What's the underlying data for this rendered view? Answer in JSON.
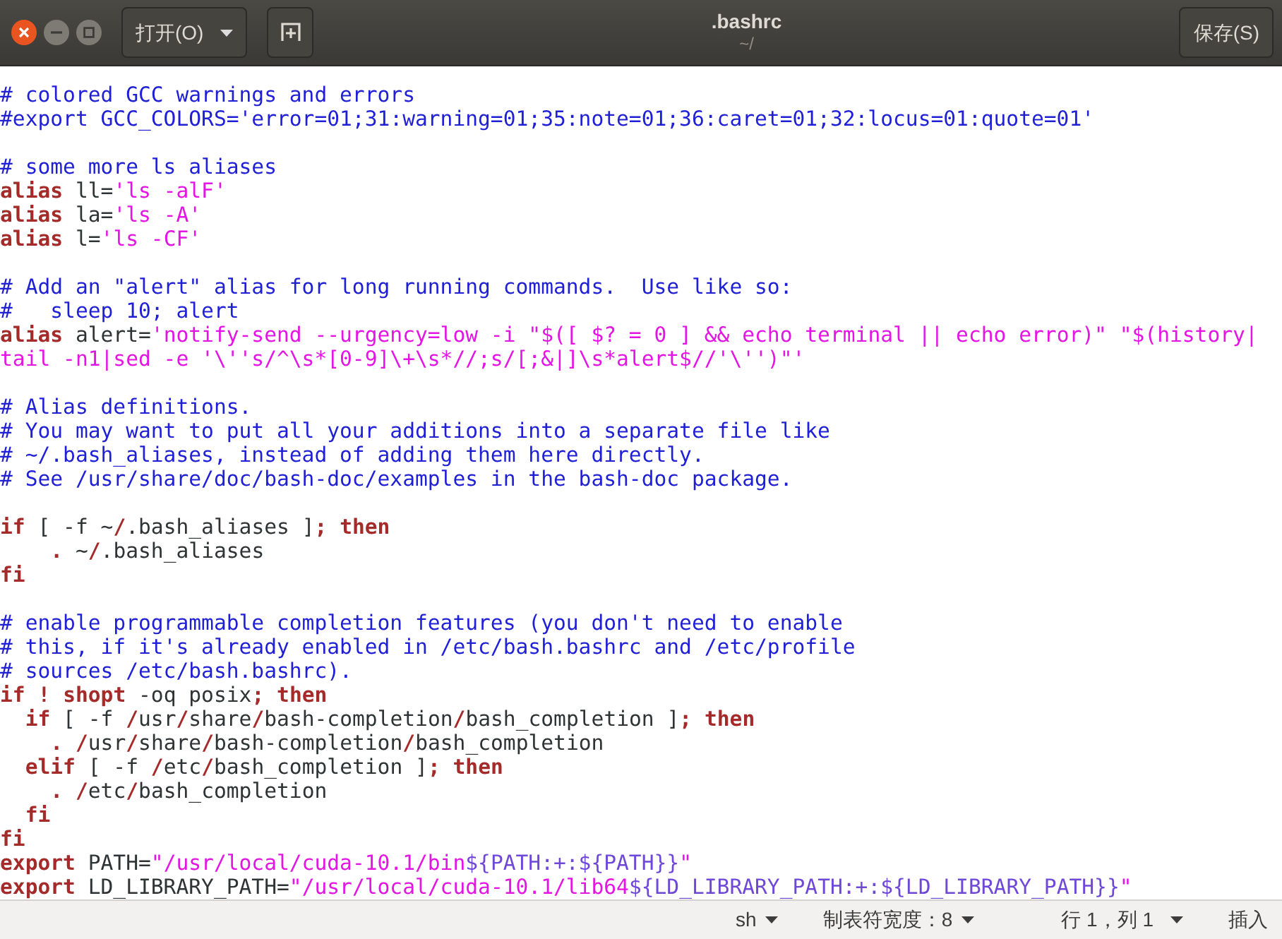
{
  "window": {
    "title": ".bashrc",
    "subtitle": "~/"
  },
  "header": {
    "open_button": "打开(O)",
    "save_button": "保存(S)"
  },
  "editor": {
    "lines": [
      {
        "kind": "code",
        "segments": [
          {
            "kind": "comment",
            "text": "# colored GCC warnings and errors"
          }
        ]
      },
      {
        "kind": "code",
        "segments": [
          {
            "kind": "comment",
            "text": "#export GCC_COLORS='error=01;31:warning=01;35:note=01;36:caret=01;32:locus=01:quote=01'"
          }
        ]
      },
      {
        "kind": "blank"
      },
      {
        "kind": "code",
        "segments": [
          {
            "kind": "comment",
            "text": "# some more ls aliases"
          }
        ]
      },
      {
        "kind": "code",
        "segments": [
          {
            "kind": "keyword",
            "text": "alias"
          },
          {
            "kind": "plain",
            "text": " ll="
          },
          {
            "kind": "string",
            "text": "'ls -alF'"
          }
        ]
      },
      {
        "kind": "code",
        "segments": [
          {
            "kind": "keyword",
            "text": "alias"
          },
          {
            "kind": "plain",
            "text": " la="
          },
          {
            "kind": "string",
            "text": "'ls -A'"
          }
        ]
      },
      {
        "kind": "code",
        "segments": [
          {
            "kind": "keyword",
            "text": "alias"
          },
          {
            "kind": "plain",
            "text": " l="
          },
          {
            "kind": "string",
            "text": "'ls -CF'"
          }
        ]
      },
      {
        "kind": "blank"
      },
      {
        "kind": "code",
        "segments": [
          {
            "kind": "comment",
            "text": "# Add an \"alert\" alias for long running commands.  Use like so:"
          }
        ]
      },
      {
        "kind": "code",
        "segments": [
          {
            "kind": "comment",
            "text": "#   sleep 10; alert"
          }
        ]
      },
      {
        "kind": "code",
        "segments": [
          {
            "kind": "keyword",
            "text": "alias"
          },
          {
            "kind": "plain",
            "text": " alert="
          },
          {
            "kind": "string",
            "text": "'notify-send --urgency=low -i \"$([ $? = 0 ] && echo terminal || echo error)\" \"$(history|"
          }
        ]
      },
      {
        "kind": "code",
        "segments": [
          {
            "kind": "string",
            "text": "tail -n1|sed -e '\\''s/^\\s*[0-9]\\+\\s*//;s/[;&|]\\s*alert$//'\\'')\"'"
          }
        ]
      },
      {
        "kind": "blank"
      },
      {
        "kind": "code",
        "segments": [
          {
            "kind": "comment",
            "text": "# Alias definitions."
          }
        ]
      },
      {
        "kind": "code",
        "segments": [
          {
            "kind": "comment",
            "text": "# You may want to put all your additions into a separate file like"
          }
        ]
      },
      {
        "kind": "code",
        "segments": [
          {
            "kind": "comment",
            "text": "# ~/.bash_aliases, instead of adding them here directly."
          }
        ]
      },
      {
        "kind": "code",
        "segments": [
          {
            "kind": "comment",
            "text": "# See /usr/share/doc/bash-doc/examples in the bash-doc package."
          }
        ]
      },
      {
        "kind": "blank"
      },
      {
        "kind": "code",
        "segments": [
          {
            "kind": "keyword",
            "text": "if"
          },
          {
            "kind": "plain",
            "text": " [ -f ~"
          },
          {
            "kind": "operator",
            "text": "/"
          },
          {
            "kind": "plain",
            "text": ".bash_aliases ]"
          },
          {
            "kind": "operator",
            "text": ";"
          },
          {
            "kind": "keyword",
            "text": " then"
          }
        ]
      },
      {
        "kind": "code",
        "segments": [
          {
            "kind": "operator",
            "text": "    ."
          },
          {
            "kind": "plain",
            "text": " ~"
          },
          {
            "kind": "operator",
            "text": "/"
          },
          {
            "kind": "plain",
            "text": ".bash_aliases"
          }
        ]
      },
      {
        "kind": "code",
        "segments": [
          {
            "kind": "keyword",
            "text": "fi"
          }
        ]
      },
      {
        "kind": "blank"
      },
      {
        "kind": "code",
        "segments": [
          {
            "kind": "comment",
            "text": "# enable programmable completion features (you don't need to enable"
          }
        ]
      },
      {
        "kind": "code",
        "segments": [
          {
            "kind": "comment",
            "text": "# this, if it's already enabled in /etc/bash.bashrc and /etc/profile"
          }
        ]
      },
      {
        "kind": "code",
        "segments": [
          {
            "kind": "comment",
            "text": "# sources /etc/bash.bashrc)."
          }
        ]
      },
      {
        "kind": "code",
        "segments": [
          {
            "kind": "keyword",
            "text": "if"
          },
          {
            "kind": "operator",
            "text": " !"
          },
          {
            "kind": "keyword",
            "text": " shopt"
          },
          {
            "kind": "plain",
            "text": " -oq posix"
          },
          {
            "kind": "operator",
            "text": ";"
          },
          {
            "kind": "keyword",
            "text": " then"
          }
        ]
      },
      {
        "kind": "code",
        "segments": [
          {
            "kind": "keyword",
            "text": "  if"
          },
          {
            "kind": "plain",
            "text": " [ -f "
          },
          {
            "kind": "operator",
            "text": "/"
          },
          {
            "kind": "plain",
            "text": "usr"
          },
          {
            "kind": "operator",
            "text": "/"
          },
          {
            "kind": "plain",
            "text": "share"
          },
          {
            "kind": "operator",
            "text": "/"
          },
          {
            "kind": "plain",
            "text": "bash-completion"
          },
          {
            "kind": "operator",
            "text": "/"
          },
          {
            "kind": "plain",
            "text": "bash_completion ]"
          },
          {
            "kind": "operator",
            "text": ";"
          },
          {
            "kind": "keyword",
            "text": " then"
          }
        ]
      },
      {
        "kind": "code",
        "segments": [
          {
            "kind": "operator",
            "text": "    ."
          },
          {
            "kind": "operator",
            "text": " /"
          },
          {
            "kind": "plain",
            "text": "usr"
          },
          {
            "kind": "operator",
            "text": "/"
          },
          {
            "kind": "plain",
            "text": "share"
          },
          {
            "kind": "operator",
            "text": "/"
          },
          {
            "kind": "plain",
            "text": "bash-completion"
          },
          {
            "kind": "operator",
            "text": "/"
          },
          {
            "kind": "plain",
            "text": "bash_completion"
          }
        ]
      },
      {
        "kind": "code",
        "segments": [
          {
            "kind": "keyword",
            "text": "  elif"
          },
          {
            "kind": "plain",
            "text": " [ -f "
          },
          {
            "kind": "operator",
            "text": "/"
          },
          {
            "kind": "plain",
            "text": "etc"
          },
          {
            "kind": "operator",
            "text": "/"
          },
          {
            "kind": "plain",
            "text": "bash_completion ]"
          },
          {
            "kind": "operator",
            "text": ";"
          },
          {
            "kind": "keyword",
            "text": " then"
          }
        ]
      },
      {
        "kind": "code",
        "segments": [
          {
            "kind": "operator",
            "text": "    ."
          },
          {
            "kind": "operator",
            "text": " /"
          },
          {
            "kind": "plain",
            "text": "etc"
          },
          {
            "kind": "operator",
            "text": "/"
          },
          {
            "kind": "plain",
            "text": "bash_completion"
          }
        ]
      },
      {
        "kind": "code",
        "segments": [
          {
            "kind": "keyword",
            "text": "  fi"
          }
        ]
      },
      {
        "kind": "code",
        "segments": [
          {
            "kind": "keyword",
            "text": "fi"
          }
        ]
      },
      {
        "kind": "code",
        "segments": [
          {
            "kind": "keyword",
            "text": "export"
          },
          {
            "kind": "plain",
            "text": " PATH="
          },
          {
            "kind": "string",
            "text": "\"/usr/local/cuda-10.1/bin"
          },
          {
            "kind": "variable",
            "text": "${PATH:+:${PATH}}"
          },
          {
            "kind": "string",
            "text": "\""
          }
        ]
      },
      {
        "kind": "code",
        "segments": [
          {
            "kind": "keyword",
            "text": "export"
          },
          {
            "kind": "plain",
            "text": " LD_LIBRARY_PATH="
          },
          {
            "kind": "string",
            "text": "\"/usr/local/cuda-10.1/lib64"
          },
          {
            "kind": "variable",
            "text": "${LD_LIBRARY_PATH:+:${LD_LIBRARY_PATH}}"
          },
          {
            "kind": "string",
            "text": "\""
          }
        ]
      }
    ]
  },
  "status_bar": {
    "language": "sh",
    "tab_width": "制表符宽度：8",
    "position": "行 1，列 1",
    "mode": "插入"
  }
}
